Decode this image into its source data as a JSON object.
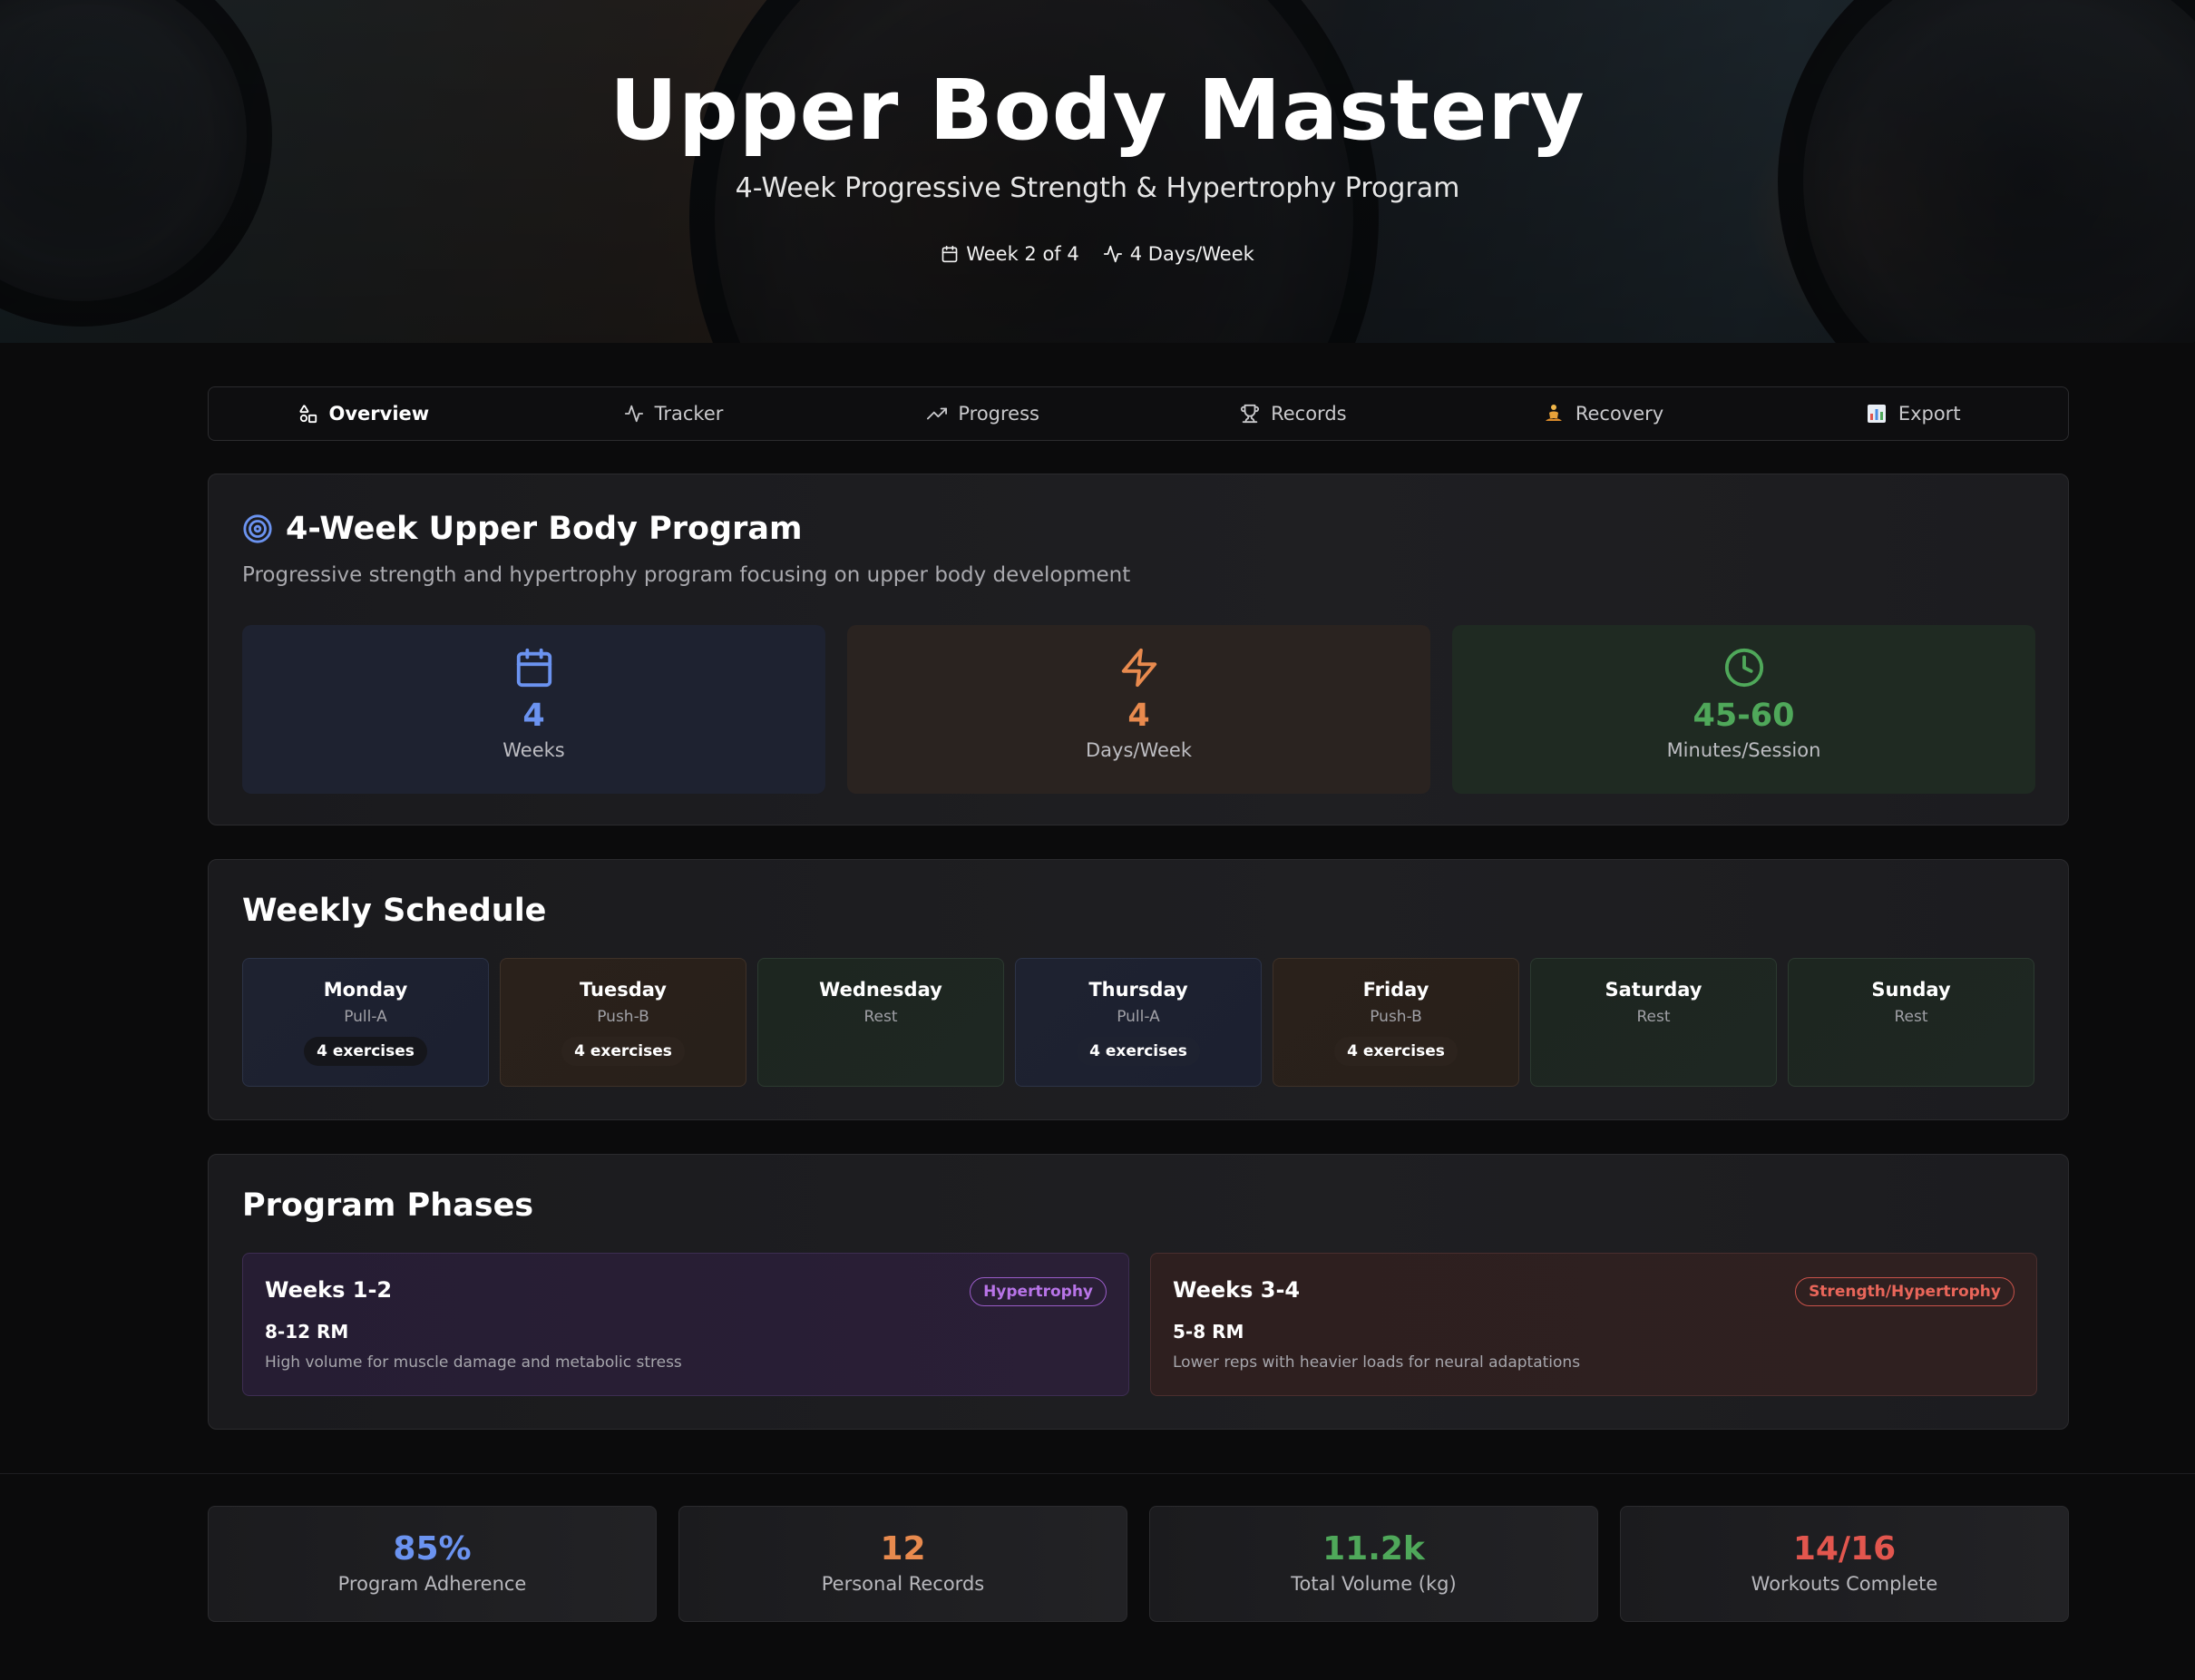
{
  "hero": {
    "title": "Upper Body Mastery",
    "subtitle": "4-Week Progressive Strength & Hypertrophy Program",
    "meta": [
      {
        "icon": "calendar-icon",
        "label": "Week 2 of 4"
      },
      {
        "icon": "activity-icon",
        "label": "4 Days/Week"
      }
    ]
  },
  "tabs": [
    {
      "icon": "shapes-icon",
      "label": "Overview",
      "active": true
    },
    {
      "icon": "activity-icon",
      "label": "Tracker"
    },
    {
      "icon": "trending-up-icon",
      "label": "Progress"
    },
    {
      "icon": "trophy-icon",
      "label": "Records"
    },
    {
      "icon": "meditation-emoji-icon",
      "label": "Recovery"
    },
    {
      "icon": "bar-chart-emoji-icon",
      "label": "Export"
    }
  ],
  "program": {
    "title": "4-Week Upper Body Program",
    "description": "Progressive strength and hypertrophy program focusing on upper body development",
    "stats": [
      {
        "icon": "calendar-icon",
        "value": "4",
        "label": "Weeks",
        "color": "#6b93f0"
      },
      {
        "icon": "zap-icon",
        "value": "4",
        "label": "Days/Week",
        "color": "#e88a4e"
      },
      {
        "icon": "clock-icon",
        "value": "45-60",
        "label": "Minutes/Session",
        "color": "#4fa85a"
      }
    ]
  },
  "schedule": {
    "title": "Weekly Schedule",
    "days": [
      {
        "name": "Monday",
        "type": "Pull-A",
        "exercises": "4 exercises"
      },
      {
        "name": "Tuesday",
        "type": "Push-B",
        "exercises": "4 exercises"
      },
      {
        "name": "Wednesday",
        "type": "Rest",
        "exercises": ""
      },
      {
        "name": "Thursday",
        "type": "Pull-A",
        "exercises": "4 exercises"
      },
      {
        "name": "Friday",
        "type": "Push-B",
        "exercises": "4 exercises"
      },
      {
        "name": "Saturday",
        "type": "Rest",
        "exercises": ""
      },
      {
        "name": "Sunday",
        "type": "Rest",
        "exercises": ""
      }
    ]
  },
  "phases": {
    "title": "Program Phases",
    "items": [
      {
        "weeks": "Weeks 1-2",
        "badge": "Hypertrophy",
        "rm": "8-12 RM",
        "description": "High volume for muscle damage and metabolic stress"
      },
      {
        "weeks": "Weeks 3-4",
        "badge": "Strength/Hypertrophy",
        "rm": "5-8 RM",
        "description": "Lower reps with heavier loads for neural adaptations"
      }
    ]
  },
  "footer_stats": [
    {
      "value": "85%",
      "label": "Program Adherence",
      "color": "#6b93f0"
    },
    {
      "value": "12",
      "label": "Personal Records",
      "color": "#e88a4e"
    },
    {
      "value": "11.2k",
      "label": "Total Volume (kg)",
      "color": "#4fa85a"
    },
    {
      "value": "14/16",
      "label": "Workouts Complete",
      "color": "#e2564e"
    }
  ]
}
